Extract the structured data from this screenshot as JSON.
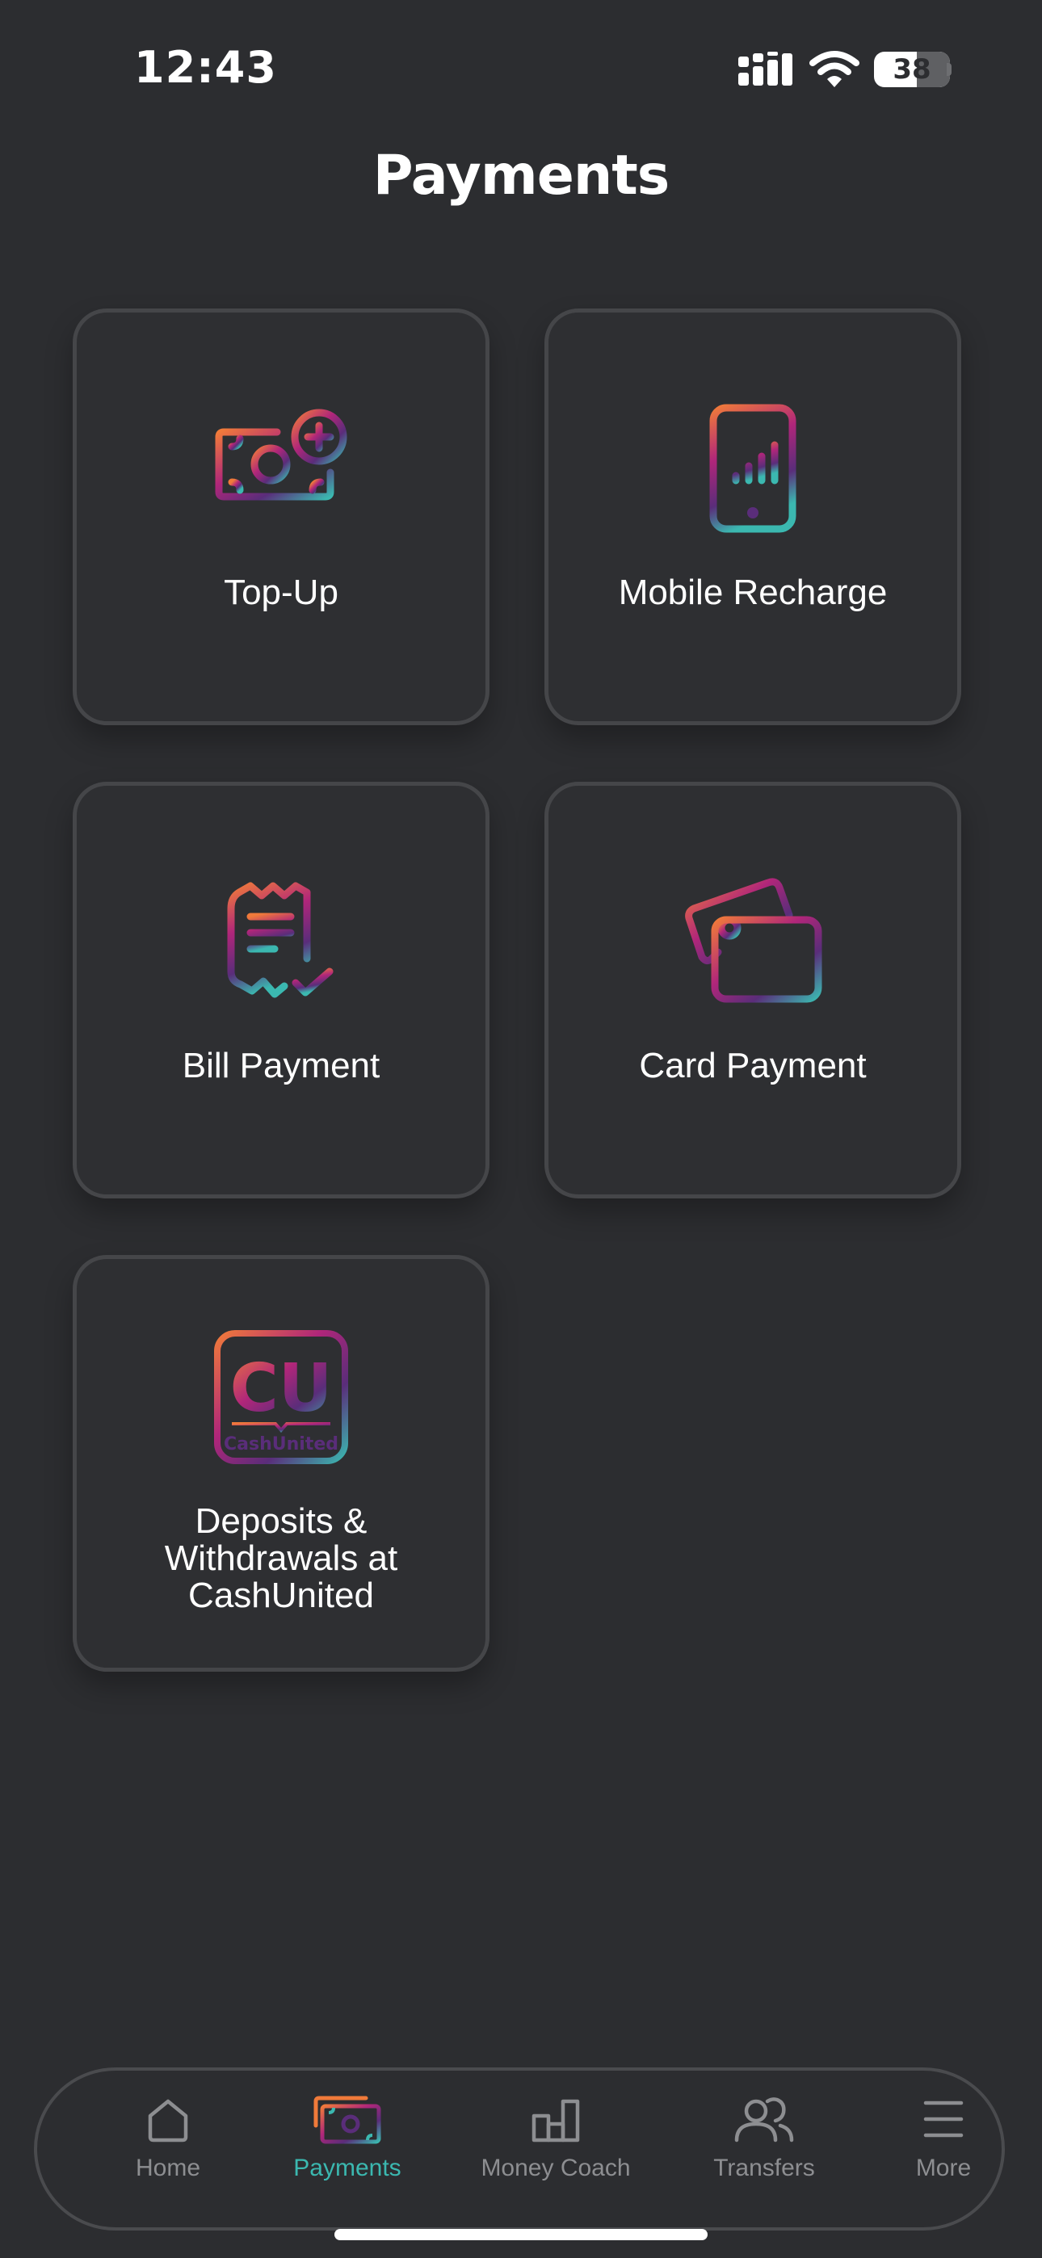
{
  "status_bar": {
    "time": "12:43",
    "battery": "38",
    "signal_icon": "cellular-signal-icon",
    "wifi_icon": "wifi-icon",
    "battery_icon": "battery-icon"
  },
  "header": {
    "title": "Payments"
  },
  "tiles": [
    {
      "label": "Top-Up",
      "icon": "cash-plus-icon"
    },
    {
      "label": "Mobile Recharge",
      "icon": "mobile-phone-signal-icon"
    },
    {
      "label": "Bill Payment",
      "icon": "receipt-check-icon"
    },
    {
      "label": "Card Payment",
      "icon": "cards-icon"
    },
    {
      "label": "Deposits & Withdrawals at CashUnited",
      "icon": "cashunited-logo-icon",
      "logo_text": "CU",
      "logo_subtext": "CashUnited"
    }
  ],
  "tab_bar": {
    "items": [
      {
        "label": "Home",
        "icon": "home-icon",
        "active": false
      },
      {
        "label": "Payments",
        "icon": "payments-icon",
        "active": true
      },
      {
        "label": "Money Coach",
        "icon": "bar-chart-icon",
        "active": false
      },
      {
        "label": "Transfers",
        "icon": "users-icon",
        "active": false
      },
      {
        "label": "More",
        "icon": "menu-icon",
        "active": false
      }
    ]
  },
  "colors": {
    "background": "#2c2d30",
    "tile_border": "#454649",
    "active_tab": "#3bb8b0",
    "inactive_tab": "#8d8e91",
    "gradient_orange": "#f07a3a",
    "gradient_magenta": "#b0267a",
    "gradient_purple": "#5a2d7a",
    "gradient_teal": "#3bb8b0"
  }
}
